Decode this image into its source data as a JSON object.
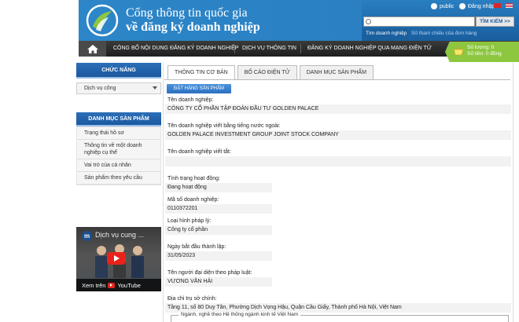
{
  "header": {
    "title_line1": "Cổng thông tin quốc gia",
    "title_line2": "về đăng ký doanh nghiệp",
    "public_label": "public",
    "logout_label": "Đăng nhập",
    "search_placeholder": "",
    "search_button": "TÌM KIẾM >>",
    "search_tab_active": "Tìm doanh nghiệp",
    "search_tab_other": "Số tham chiếu của đơn hàng"
  },
  "nav": {
    "items": [
      "CÔNG BỐ NỘI DUNG ĐĂNG KÝ DOANH NGHIỆP",
      "DỊCH VỤ THÔNG TIN",
      "ĐĂNG KÝ DOANH NGHIỆP QUA MẠNG ĐIỆN TỬ"
    ]
  },
  "basket": {
    "quantity_line": "Số lượng: 0",
    "amount_line": "Số tiền: 0 đồng"
  },
  "sidebar": {
    "functions_title": "CHỨC NĂNG",
    "service_select": "Dịch vụ công",
    "catalog_title": "DANH MỤC SẢN PHẨM",
    "catalog_items": [
      "Trạng thái hồ sơ",
      "Thông tin về một doanh nghiệp cụ thể",
      "Vai trò của cá nhân",
      "Sản phẩm theo yêu cầu"
    ],
    "video": {
      "channel_letter": "m",
      "title": "Dịch vụ cung ...",
      "watch_on": "Xem trên",
      "platform": "YouTube"
    }
  },
  "main": {
    "tabs": [
      "THÔNG TIN CƠ BẢN",
      "BỐ CÁO ĐIỆN TỬ",
      "DANH MỤC SẢN PHẨM"
    ],
    "order_button": "ĐẶT HÀNG SẢN PHẨM",
    "fields": {
      "name_label": "Tên doanh nghiệp:",
      "name_value": "CÔNG TY CỔ PHẦN TẬP ĐOÀN ĐẦU TƯ GOLDEN PALACE",
      "foreign_name_label": "Tên doanh nghiệp viết bằng tiếng nước ngoài:",
      "foreign_name_value": "GOLDEN PALACE INVESTMENT GROUP JOINT STOCK COMPANY",
      "short_name_label": "Tên doanh nghiệp viết tắt:",
      "short_name_value": "",
      "status_label": "Tình trạng hoạt động:",
      "status_value": "Đang hoạt động",
      "code_label": "Mã số doanh nghiệp:",
      "code_value": "0110372201",
      "type_label": "Loại hình pháp lý:",
      "type_value": "Công ty cổ phần",
      "start_label": "Ngày bắt đầu thành lập:",
      "start_value": "31/05/2023",
      "rep_label": "Tên người đại diện theo pháp luật:",
      "rep_value": "VƯƠNG VĂN HẢI",
      "address_label": "Địa chỉ trụ sở chính:",
      "address_value": "Tầng 11, số 80 Duy Tân, Phường Dịch Vọng Hậu, Quận Cầu Giấy, Thành phố Hà Nội, Việt Nam"
    },
    "industry_legend": "Ngành, nghề theo Hệ thống ngành kinh tế Việt Nam"
  },
  "colors": {
    "header_blue": "#1e6aad",
    "nav_dark": "#2a2a2a",
    "basket_green": "#8dc63f",
    "sidebar_blue": "#1b58a0"
  }
}
